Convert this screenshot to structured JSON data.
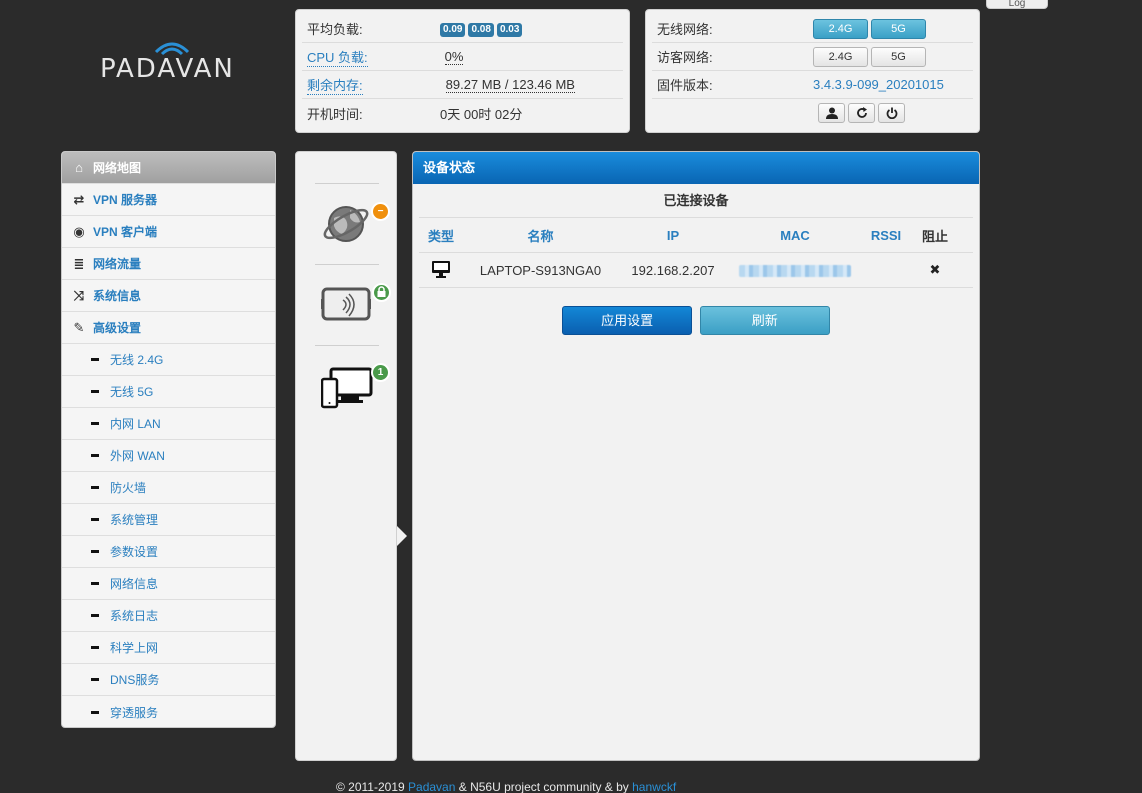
{
  "logout_tab": "Log",
  "logo": {
    "text": "PADAVAN"
  },
  "status": {
    "load_label": "平均负载:",
    "load_values": [
      "0.09",
      "0.08",
      "0.03"
    ],
    "cpu_label": "CPU 负载:",
    "cpu_value": "0%",
    "mem_label": "剩余内存:",
    "mem_value": "89.27 MB / 123.46 MB",
    "uptime_label": "开机时间:",
    "uptime_value": "0天 00时 02分"
  },
  "wireless": {
    "wifi_label": "无线网络:",
    "wifi_24": "2.4G",
    "wifi_5": "5G",
    "guest_label": "访客网络:",
    "guest_24": "2.4G",
    "guest_5": "5G",
    "fw_label": "固件版本:",
    "fw_value": "3.4.3.9-099_20201015"
  },
  "sidebar": {
    "items": [
      {
        "label": "网络地图",
        "icon": "home-icon",
        "glyph": "⌂"
      },
      {
        "label": "VPN 服务器",
        "icon": "retweet-icon",
        "glyph": "⇄"
      },
      {
        "label": "VPN 客户端",
        "icon": "globe-icon",
        "glyph": "◉"
      },
      {
        "label": "网络流量",
        "icon": "list-icon",
        "glyph": "≣"
      },
      {
        "label": "系统信息",
        "icon": "random-icon",
        "glyph": "⤨"
      },
      {
        "label": "高级设置",
        "icon": "wrench-icon",
        "glyph": "✎"
      }
    ],
    "sub": [
      "无线 2.4G",
      "无线 5G",
      "内网 LAN",
      "外网 WAN",
      "防火墙",
      "系统管理",
      "参数设置",
      "网络信息",
      "系统日志",
      "科学上网",
      "DNS服务",
      "穿透服务"
    ]
  },
  "devices": {
    "client_count": "1"
  },
  "main": {
    "title": "设备状态",
    "subtitle": "已连接设备",
    "columns": [
      "类型",
      "名称",
      "IP",
      "MAC",
      "RSSI",
      "阻止"
    ],
    "rows": [
      {
        "name": "LAPTOP-S913NGA0",
        "ip": "192.168.2.207",
        "block": "✖"
      }
    ],
    "apply_label": "应用设置",
    "refresh_label": "刷新"
  },
  "footer": {
    "prefix": "© 2011-2019 ",
    "link1": "Padavan",
    "middle": " & N56U project community & by ",
    "link2": "hanwckf"
  },
  "colors": {
    "accent": "#2a7fbf",
    "header_blue": "#0965b3",
    "badge_orange": "#f0900d",
    "badge_green": "#4a9a4a"
  }
}
